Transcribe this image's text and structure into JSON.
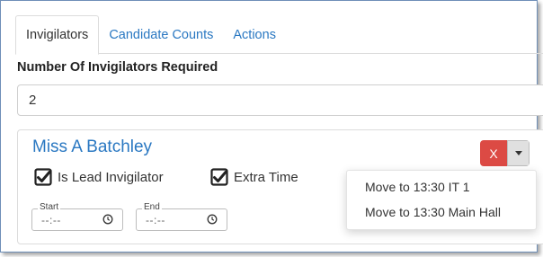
{
  "tabs": [
    {
      "label": "Invigilators",
      "active": true
    },
    {
      "label": "Candidate Counts",
      "active": false
    },
    {
      "label": "Actions",
      "active": false
    }
  ],
  "required": {
    "label": "Number Of Invigilators Required",
    "value": "2"
  },
  "invigilator": {
    "name": "Miss A Batchley",
    "lead_label": "Is Lead Invigilator",
    "lead_checked": true,
    "extra_time_label": "Extra Time",
    "extra_time_checked": true,
    "start": {
      "label": "Start",
      "value": "--:--"
    },
    "end": {
      "label": "End",
      "value": "--:--"
    },
    "remove_label": "X"
  },
  "dropdown": {
    "items": [
      {
        "label": "Move to 13:30 IT 1"
      },
      {
        "label": "Move to 13:30 Main Hall"
      }
    ]
  },
  "colors": {
    "accent": "#2a78c2",
    "danger": "#dc4a44"
  }
}
